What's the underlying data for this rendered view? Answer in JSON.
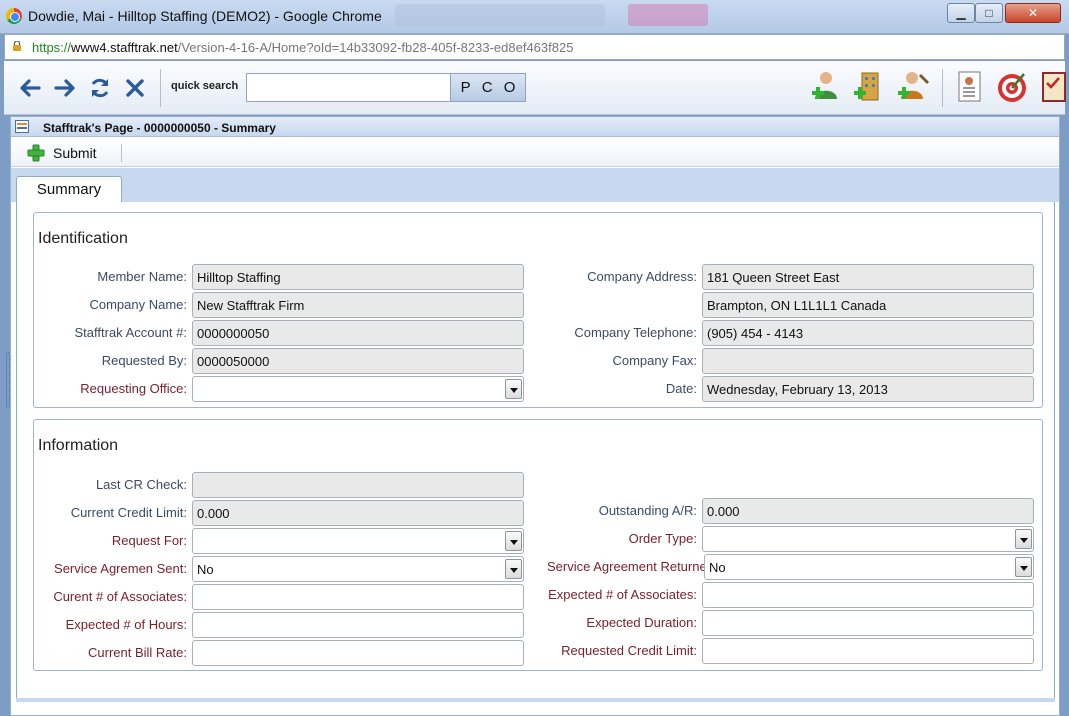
{
  "window": {
    "title": "Dowdie, Mai - Hilltop Staffing (DEMO2) - Google Chrome",
    "minimize": "▁",
    "maximize": "□",
    "close": "✕"
  },
  "address": {
    "scheme": "https://",
    "host": "www4.stafftrak.net",
    "path": "/Version-4-16-A/Home?oId=14b33092-fb28-405f-8233-ed8ef463f825"
  },
  "toolbar": {
    "quick_search_label": "quick search",
    "quick_search_value": "",
    "quick_buttons": [
      "P",
      "C",
      "O"
    ]
  },
  "page": {
    "title": "Stafftrak's Page - 0000000050 - Summary",
    "submit_label": "Submit",
    "tab_label": "Summary"
  },
  "identification": {
    "title": "Identification",
    "member_name": {
      "label": "Member Name:",
      "value": "Hilltop Staffing"
    },
    "company_name": {
      "label": "Company Name:",
      "value": "New Stafftrak Firm"
    },
    "account": {
      "label": "Stafftrak Account #:",
      "value": "0000000050"
    },
    "requested_by": {
      "label": "Requested By:",
      "value": "0000050000"
    },
    "requesting_office": {
      "label": "Requesting Office:",
      "value": ""
    },
    "company_address": {
      "label": "Company Address:",
      "line1": "181 Queen Street East",
      "line2": "Brampton, ON L1L1L1 Canada"
    },
    "company_telephone": {
      "label": "Company Telephone:",
      "value": "(905) 454 - 4143"
    },
    "company_fax": {
      "label": "Company Fax:",
      "value": ""
    },
    "date": {
      "label": "Date:",
      "value": "Wednesday, February 13, 2013"
    }
  },
  "information": {
    "title": "Information",
    "last_cr_check": {
      "label": "Last CR Check:",
      "value": ""
    },
    "current_credit_limit": {
      "label": "Current Credit Limit:",
      "value": "0.000"
    },
    "request_for": {
      "label": "Request For:",
      "value": ""
    },
    "service_agreement_sent": {
      "label": "Service Agremen Sent:",
      "value": "No"
    },
    "current_associates": {
      "label": "Curent # of Associates:",
      "value": ""
    },
    "expected_hours": {
      "label": "Expected # of Hours:",
      "value": ""
    },
    "current_bill_rate": {
      "label": "Current Bill Rate:",
      "value": ""
    },
    "outstanding_ar": {
      "label": "Outstanding A/R:",
      "value": "0.000"
    },
    "order_type": {
      "label": "Order Type:",
      "value": ""
    },
    "service_agreement_returned": {
      "label": "Service Agreement Returne",
      "value": "No"
    },
    "expected_associates": {
      "label": "Expected # of Associates:",
      "value": ""
    },
    "expected_duration": {
      "label": "Expected Duration:",
      "value": ""
    },
    "requested_credit_limit": {
      "label": "Requested Credit Limit:",
      "value": ""
    }
  },
  "colors": {
    "required_label": "#7a1f2b",
    "label": "#3c4a64",
    "accent": "#c7d8ef"
  },
  "icons": [
    "back-arrow-icon",
    "forward-arrow-icon",
    "refresh-icon",
    "stop-icon",
    "add-person-icon",
    "add-building-icon",
    "add-worker-icon",
    "document-person-icon",
    "target-icon",
    "checklist-icon",
    "page-icon",
    "plus-icon"
  ]
}
